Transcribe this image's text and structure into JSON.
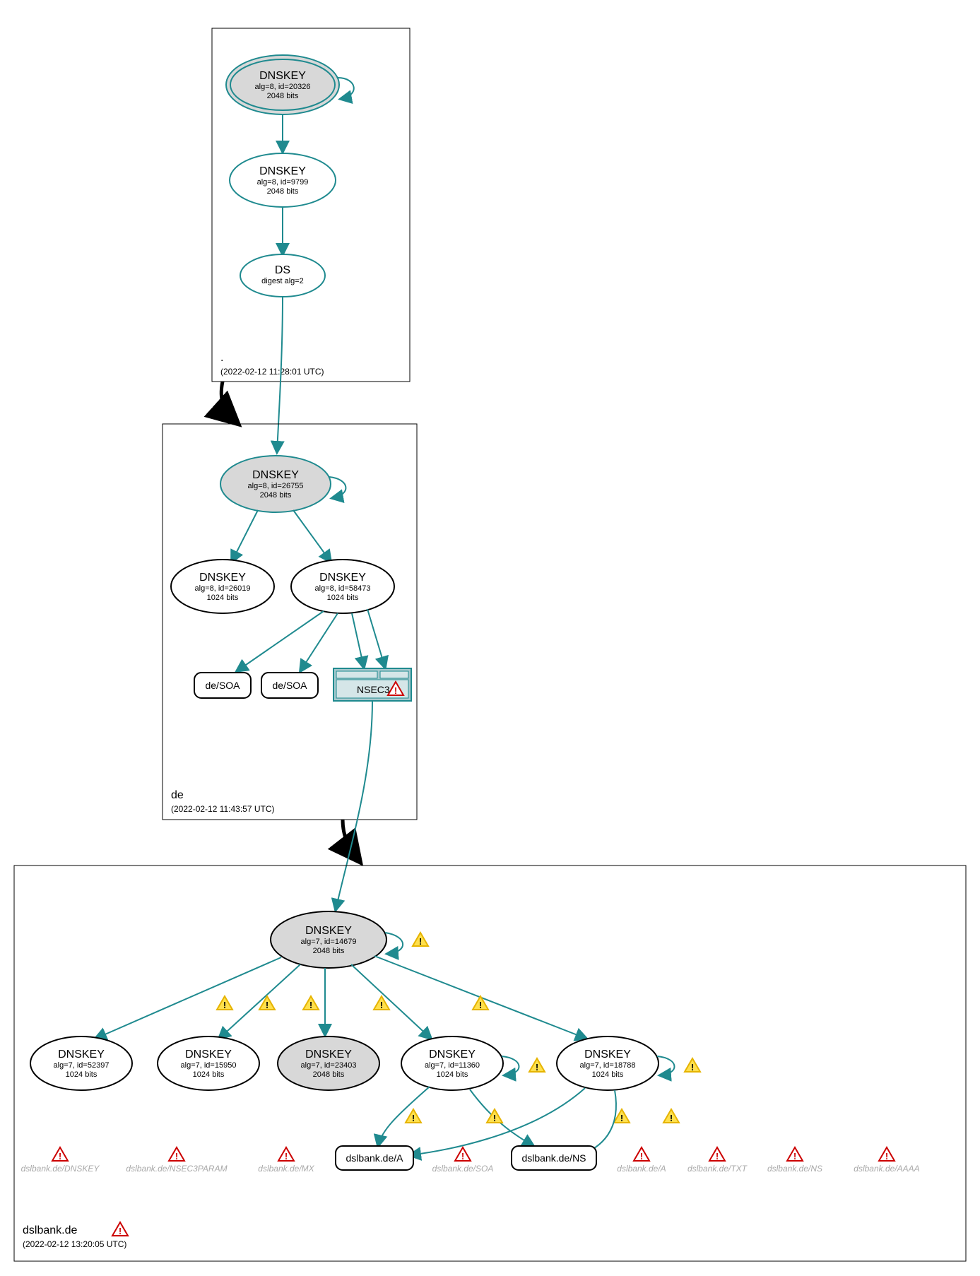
{
  "zones": {
    "root": {
      "name": ".",
      "timestamp": "(2022-02-12 11:28:01 UTC)"
    },
    "de": {
      "name": "de",
      "timestamp": "(2022-02-12 11:43:57 UTC)"
    },
    "dslbank": {
      "name": "dslbank.de",
      "timestamp": "(2022-02-12 13:20:05 UTC)"
    }
  },
  "nodes": {
    "root_ksk": {
      "title": "DNSKEY",
      "l1": "alg=8, id=20326",
      "l2": "2048 bits"
    },
    "root_zsk": {
      "title": "DNSKEY",
      "l1": "alg=8, id=9799",
      "l2": "2048 bits"
    },
    "root_ds": {
      "title": "DS",
      "l1": "digest alg=2"
    },
    "de_ksk": {
      "title": "DNSKEY",
      "l1": "alg=8, id=26755",
      "l2": "2048 bits"
    },
    "de_26019": {
      "title": "DNSKEY",
      "l1": "alg=8, id=26019",
      "l2": "1024 bits"
    },
    "de_58473": {
      "title": "DNSKEY",
      "l1": "alg=8, id=58473",
      "l2": "1024 bits"
    },
    "de_soa1": {
      "label": "de/SOA"
    },
    "de_soa2": {
      "label": "de/SOA"
    },
    "de_nsec3": {
      "label": "NSEC3"
    },
    "d_14679": {
      "title": "DNSKEY",
      "l1": "alg=7, id=14679",
      "l2": "2048 bits"
    },
    "d_52397": {
      "title": "DNSKEY",
      "l1": "alg=7, id=52397",
      "l2": "1024 bits"
    },
    "d_15950": {
      "title": "DNSKEY",
      "l1": "alg=7, id=15950",
      "l2": "1024 bits"
    },
    "d_23403": {
      "title": "DNSKEY",
      "l1": "alg=7, id=23403",
      "l2": "2048 bits"
    },
    "d_11360": {
      "title": "DNSKEY",
      "l1": "alg=7, id=11360",
      "l2": "1024 bits"
    },
    "d_18788": {
      "title": "DNSKEY",
      "l1": "alg=7, id=18788",
      "l2": "1024 bits"
    },
    "d_a": {
      "label": "dslbank.de/A"
    },
    "d_ns": {
      "label": "dslbank.de/NS"
    }
  },
  "ghosts": {
    "g1": "dslbank.de/DNSKEY",
    "g2": "dslbank.de/NSEC3PARAM",
    "g3": "dslbank.de/MX",
    "g4": "dslbank.de/SOA",
    "g5": "dslbank.de/A",
    "g6": "dslbank.de/TXT",
    "g7": "dslbank.de/NS",
    "g8": "dslbank.de/AAAA"
  }
}
